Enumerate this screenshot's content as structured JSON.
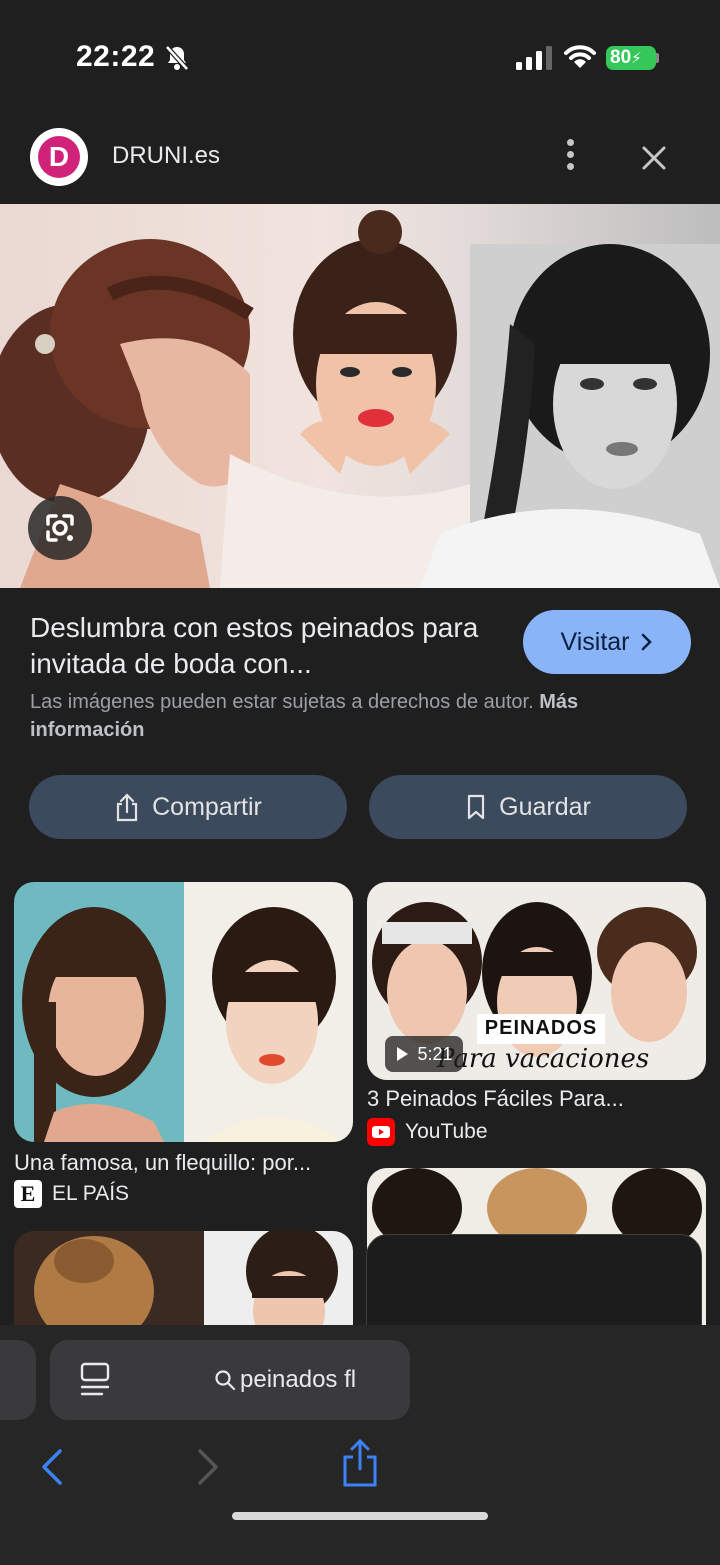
{
  "status": {
    "time": "22:22",
    "battery": "80"
  },
  "header": {
    "logo_letter": "D",
    "site_name": "DRUNI.es"
  },
  "result": {
    "title": "Deslumbra con estos peinados para invitada de boda con...",
    "visit_label": "Visitar",
    "copyright_text": "Las imágenes pueden estar sujetas a derechos de autor.",
    "more_info": "Más información",
    "share_label": "Compartir",
    "save_label": "Guardar"
  },
  "grid": [
    {
      "caption": "Una famosa, un flequillo: por...",
      "source": "EL PAÍS",
      "source_icon": "E"
    },
    {
      "caption": "3 Peinados Fáciles Para...",
      "source": "YouTube",
      "duration": "5:21",
      "overlay_title": "PEINADOS",
      "overlay_sub": "Para vacaciones"
    }
  ],
  "toolbar": {
    "search_text": "peinados fl"
  },
  "colors": {
    "accent": "#8ab4f8",
    "brand": "#d1227a",
    "battery": "#34c759",
    "youtube": "#ff0000"
  }
}
